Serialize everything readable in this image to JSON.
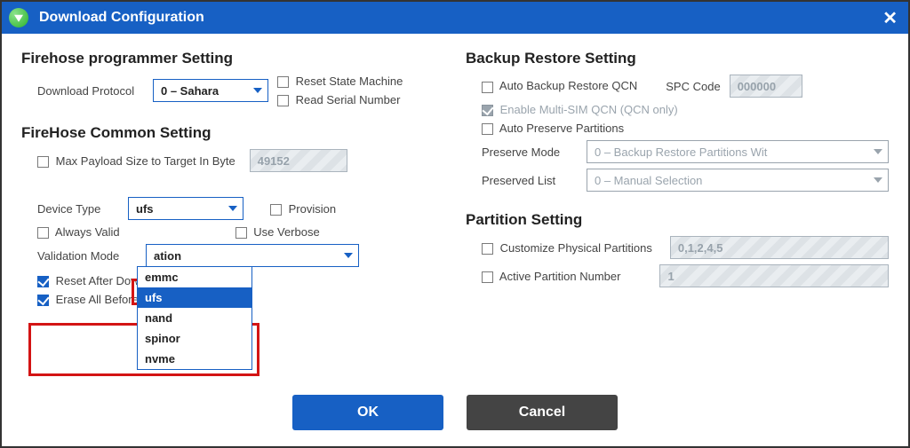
{
  "title": "Download Configuration",
  "left": {
    "firehose_prog_header": "Firehose programmer Setting",
    "download_protocol_label": "Download Protocol",
    "download_protocol_value": "0 – Sahara",
    "reset_state_machine": "Reset State Machine",
    "read_serial_number": "Read Serial Number",
    "common_header": "FireHose Common Setting",
    "max_payload_label": "Max Payload Size to Target In Byte",
    "max_payload_value": "49152",
    "device_type_label": "Device Type",
    "device_type_value": "ufs",
    "device_type_options": [
      "emmc",
      "ufs",
      "nand",
      "spinor",
      "nvme"
    ],
    "provision": "Provision",
    "always_valid": "Always Valid",
    "use_verbose": "Use Verbose",
    "validation_mode_label": "Validation Mode",
    "validation_mode_value": "ation",
    "reset_after_download": "Reset After Download",
    "erase_all_before": "Erase All Before Download"
  },
  "right": {
    "backup_header": "Backup Restore Setting",
    "auto_backup": "Auto Backup Restore QCN",
    "spc_code_label": "SPC Code",
    "spc_code_value": "000000",
    "enable_multisim": "Enable Multi-SIM QCN (QCN only)",
    "auto_preserve": "Auto Preserve Partitions",
    "preserve_mode_label": "Preserve Mode",
    "preserve_mode_value": "0 – Backup Restore Partitions Wit",
    "preserved_list_label": "Preserved List",
    "preserved_list_value": "0 – Manual Selection",
    "partition_header": "Partition Setting",
    "customize_partitions": "Customize Physical Partitions",
    "customize_value": "0,1,2,4,5",
    "active_partition": "Active Partition Number",
    "active_value": "1"
  },
  "buttons": {
    "ok": "OK",
    "cancel": "Cancel"
  }
}
